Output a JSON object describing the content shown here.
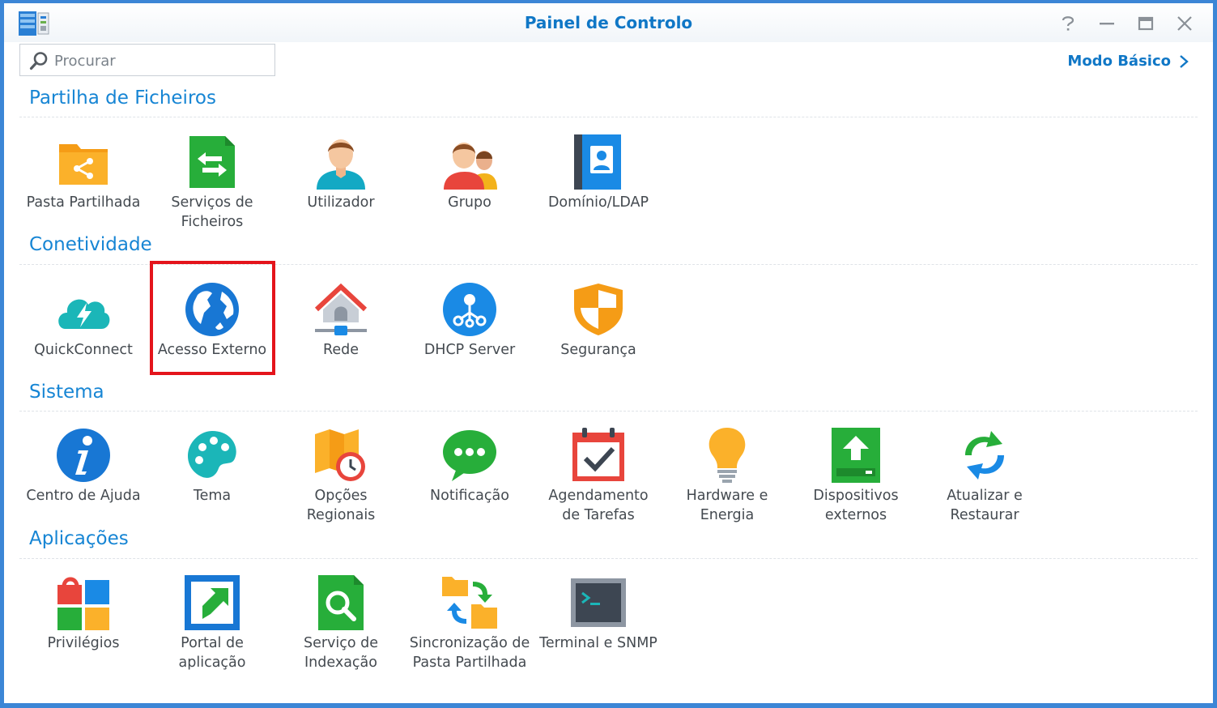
{
  "window": {
    "title": "Painel de Controlo"
  },
  "search": {
    "placeholder": "Procurar"
  },
  "mode_link": "Modo Básico",
  "colors": {
    "accent": "#1077c6",
    "highlight": "#e4141b",
    "desktop": "#3c86d6"
  },
  "sections": [
    {
      "title": "Partilha de Ficheiros",
      "items": [
        {
          "label": "Pasta Partilhada",
          "icon": "shared-folder-icon"
        },
        {
          "label": "Serviços de Ficheiros",
          "icon": "file-services-icon"
        },
        {
          "label": "Utilizador",
          "icon": "user-icon"
        },
        {
          "label": "Grupo",
          "icon": "group-icon"
        },
        {
          "label": "Domínio/LDAP",
          "icon": "domain-ldap-icon"
        }
      ]
    },
    {
      "title": "Conetividade",
      "items": [
        {
          "label": "QuickConnect",
          "icon": "quickconnect-icon"
        },
        {
          "label": "Acesso Externo",
          "icon": "globe-icon",
          "highlighted": true
        },
        {
          "label": "Rede",
          "icon": "network-icon"
        },
        {
          "label": "DHCP Server",
          "icon": "dhcp-server-icon"
        },
        {
          "label": "Segurança",
          "icon": "security-shield-icon"
        }
      ]
    },
    {
      "title": "Sistema",
      "items": [
        {
          "label": "Centro de Ajuda",
          "icon": "info-icon"
        },
        {
          "label": "Tema",
          "icon": "palette-icon"
        },
        {
          "label": "Opções Regionais",
          "icon": "regional-options-icon"
        },
        {
          "label": "Notificação",
          "icon": "notification-icon"
        },
        {
          "label": "Agendamento de Tarefas",
          "icon": "calendar-check-icon"
        },
        {
          "label": "Hardware e Energia",
          "icon": "lightbulb-icon"
        },
        {
          "label": "Dispositivos externos",
          "icon": "external-device-icon"
        },
        {
          "label": "Atualizar e Restaurar",
          "icon": "update-restore-icon"
        }
      ]
    },
    {
      "title": "Aplicações",
      "items": [
        {
          "label": "Privilégios",
          "icon": "privileges-icon"
        },
        {
          "label": "Portal de aplicação",
          "icon": "application-portal-icon"
        },
        {
          "label": "Serviço de Indexação",
          "icon": "indexing-service-icon"
        },
        {
          "label": "Sincronização de Pasta Partilhada",
          "icon": "shared-folder-sync-icon"
        },
        {
          "label": "Terminal e SNMP",
          "icon": "terminal-icon"
        }
      ]
    }
  ]
}
